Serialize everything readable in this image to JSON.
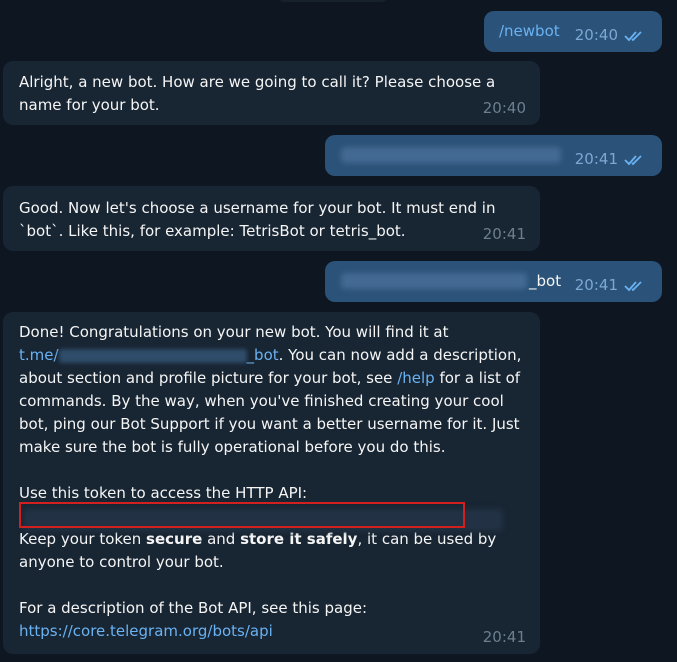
{
  "messages": {
    "m1": {
      "text": "/newbot",
      "time": "20:40"
    },
    "m2": {
      "line1": "Alright, a new bot. How are we going to call it? Please choose a",
      "line2": "name for your bot.",
      "time": "20:40"
    },
    "m3": {
      "time": "20:41"
    },
    "m4": {
      "line1": "Good. Now let's choose a username for your bot. It must end in",
      "line2": "`bot`. Like this, for example: TetrisBot or tetris_bot.",
      "time": "20:41"
    },
    "m5": {
      "suffix": "_bot",
      "time": "20:41"
    },
    "m6": {
      "l1": "Done! Congratulations on your new bot. You will find it at",
      "l2_link_prefix": "t.me/",
      "l2_link_suffix": "_bot",
      "l2_rest": ". You can now add a description,",
      "l3": "about section and profile picture for your bot, see ",
      "l3_link": "/help",
      "l3_rest": " for a list of",
      "l4": "commands. By the way, when you've finished creating your cool",
      "l5": "bot, ping our Bot Support if you want a better username for it. Just",
      "l6": "make sure the bot is fully operational before you do this.",
      "l7": "Use this token to access the HTTP API:",
      "l8_a": "Keep your token ",
      "l8_b": "secure",
      "l8_c": " and ",
      "l8_d": "store it safely",
      "l8_e": ", it can be used by",
      "l9": "anyone to control your bot.",
      "l10": "For a description of the Bot API, see this page:",
      "l11_link": "https://core.telegram.org/bots/api",
      "time": "20:41"
    }
  },
  "colors": {
    "background": "#0e1621",
    "incoming": "#182533",
    "outgoing": "#2b5278",
    "link": "#6ab2f2",
    "highlight": "#d21f1f"
  },
  "icons": {
    "read": "double-check-icon"
  }
}
